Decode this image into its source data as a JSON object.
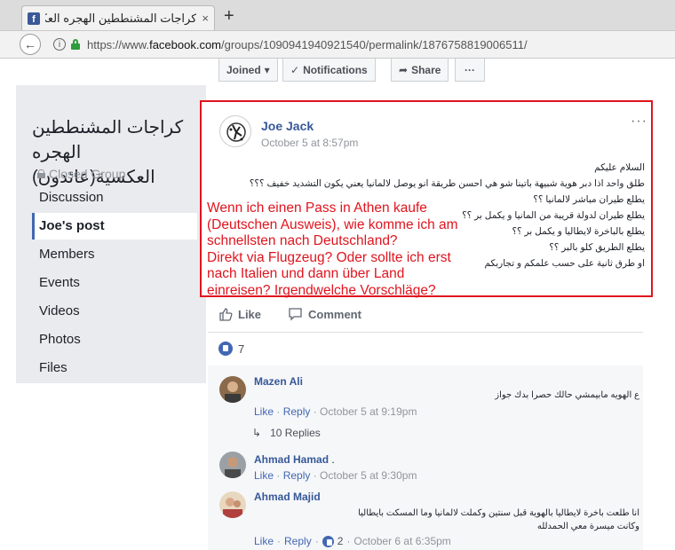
{
  "browser": {
    "tab_title": "كراجات المشنططين الهجره العكسـ",
    "tab_close": "×",
    "new_tab": "+",
    "url_prefix": "https://www.",
    "url_domain": "facebook.com",
    "url_path": "/groups/1090941940921540/permalink/1876758819006511/"
  },
  "group_bar": {
    "joined_label": "Joined",
    "notifications_label": "Notifications",
    "share_label": "Share",
    "more_label": "···"
  },
  "sidebar": {
    "group_name": "كراجات المشنططين الهجره العكسية(عائدون)",
    "privacy": "Closed Group",
    "items": [
      {
        "label": "Discussion"
      },
      {
        "label": "Joe's post"
      },
      {
        "label": "Members"
      },
      {
        "label": "Events"
      },
      {
        "label": "Videos"
      },
      {
        "label": "Photos"
      },
      {
        "label": "Files"
      }
    ]
  },
  "post": {
    "author": "Joe Jack",
    "time": "October 5 at 8:57pm",
    "more": "···",
    "arabic_lines": [
      "السلام عليكم",
      "طلق واحد اذا دبر هوية شبيهة باتينا شو هي احسن طريقة انو يوصل لالمانيا يعني يكون التشديد خفيف ؟؟؟",
      "يطلع طيران مباشر لالمانيا ؟؟",
      "يطلع طيران لدولة قريبة من المانيا و يكمل بر ؟؟",
      "يطلع بالباخرة لايطاليا و يكمل بر ؟؟",
      "يطلع الطريق كلو بالبر ؟؟",
      "او طرق ثانية على حسب علمكم و تجاربكم"
    ],
    "translation_lines": [
      "Wenn ich einen Pass in Athen kaufe",
      "(Deutschen Ausweis), wie komme ich am",
      "schnellsten nach Deutschland?",
      "Direkt via Flugzeug? Oder sollte ich erst",
      "nach Italien und dann über Land",
      "einreisen? Irgendwelche Vorschläge?"
    ],
    "like_label": "Like",
    "comment_label": "Comment",
    "like_count": "7"
  },
  "comments": [
    {
      "name": "Mazen Ali",
      "text": "ع الهويه مابيمشي حالك حصرا بدك جواز",
      "like": "Like",
      "reply": "Reply",
      "time": "October 5 at 9:19pm",
      "replies": "10 Replies"
    },
    {
      "name": "Ahmad Hamad",
      "name_suffix": ".",
      "like": "Like",
      "reply": "Reply",
      "time": "October 5 at 9:30pm"
    },
    {
      "name": "Ahmad Majid",
      "text_lines": [
        "انا طلعت باخرة لايطاليا بالهوية قبل سنتين وكملت لالمانيا وما المسكت بايطاليا",
        "وكانت ميسرة معي الحمدلله"
      ],
      "like": "Like",
      "reply": "Reply",
      "reactions": "2",
      "time": "October 6 at 6:35pm"
    }
  ],
  "colors": {
    "accent": "#4267b2",
    "link": "#365899",
    "highlight_border": "#e0141e",
    "translation_text": "#e0141e"
  }
}
